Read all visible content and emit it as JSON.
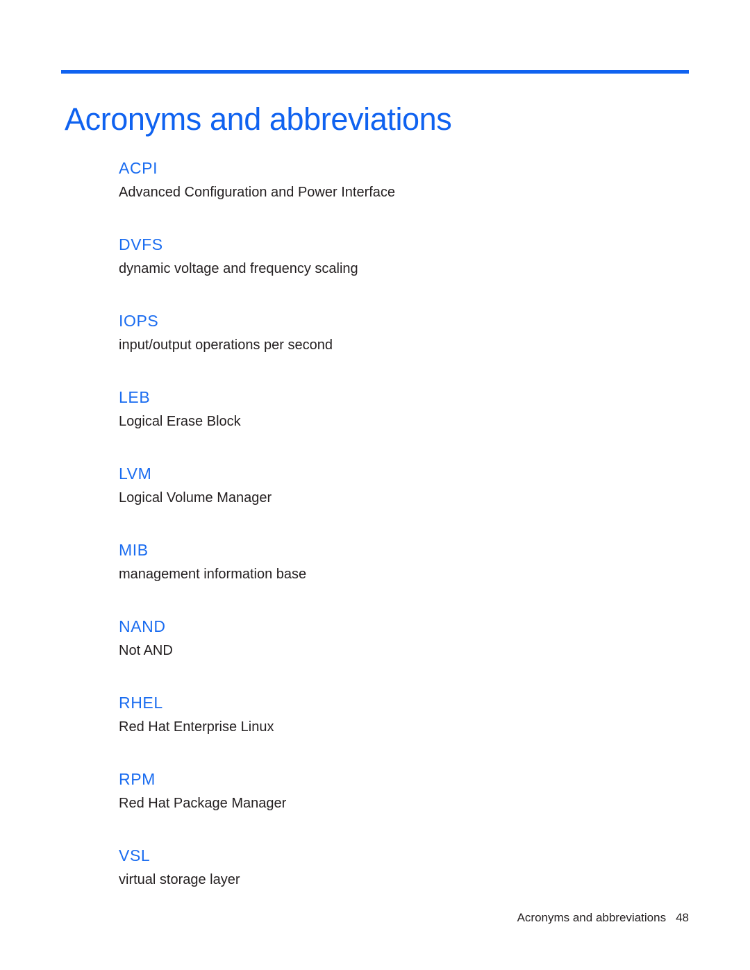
{
  "document": {
    "title": "Acronyms and abbreviations",
    "accent_color": "#0F62F0",
    "term_color": "#1A6CF0",
    "body_text_color": "#231F20"
  },
  "glossary": {
    "entries": [
      {
        "term": "ACPI",
        "definition": "Advanced Configuration and Power Interface"
      },
      {
        "term": "DVFS",
        "definition": "dynamic voltage and frequency scaling"
      },
      {
        "term": "IOPS",
        "definition": "input/output operations per second"
      },
      {
        "term": "LEB",
        "definition": "Logical Erase Block"
      },
      {
        "term": "LVM",
        "definition": "Logical Volume Manager"
      },
      {
        "term": "MIB",
        "definition": "management information base"
      },
      {
        "term": "NAND",
        "definition": "Not AND"
      },
      {
        "term": "RHEL",
        "definition": "Red Hat Enterprise Linux"
      },
      {
        "term": "RPM",
        "definition": "Red Hat Package Manager"
      },
      {
        "term": "VSL",
        "definition": "virtual storage layer"
      }
    ]
  },
  "footer": {
    "section_label": "Acronyms and abbreviations",
    "page_number": "48"
  }
}
